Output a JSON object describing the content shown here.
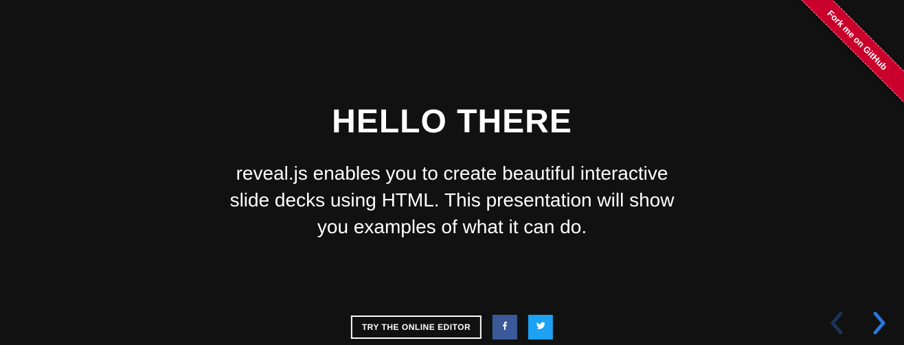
{
  "ribbon": {
    "label": "Fork me on GitHub"
  },
  "slide": {
    "heading": "HELLO THERE",
    "body": "reveal.js enables you to create beautiful interactive slide decks using HTML. This presentation will show you examples of what it can do."
  },
  "footer": {
    "try_label": "TRY THE ONLINE EDITOR"
  },
  "nav": {
    "left_enabled": false,
    "right_enabled": true
  },
  "colors": {
    "accent": "#2a76dd",
    "ribbon": "#c9002b",
    "facebook": "#3b5998",
    "twitter": "#1da1f2"
  }
}
